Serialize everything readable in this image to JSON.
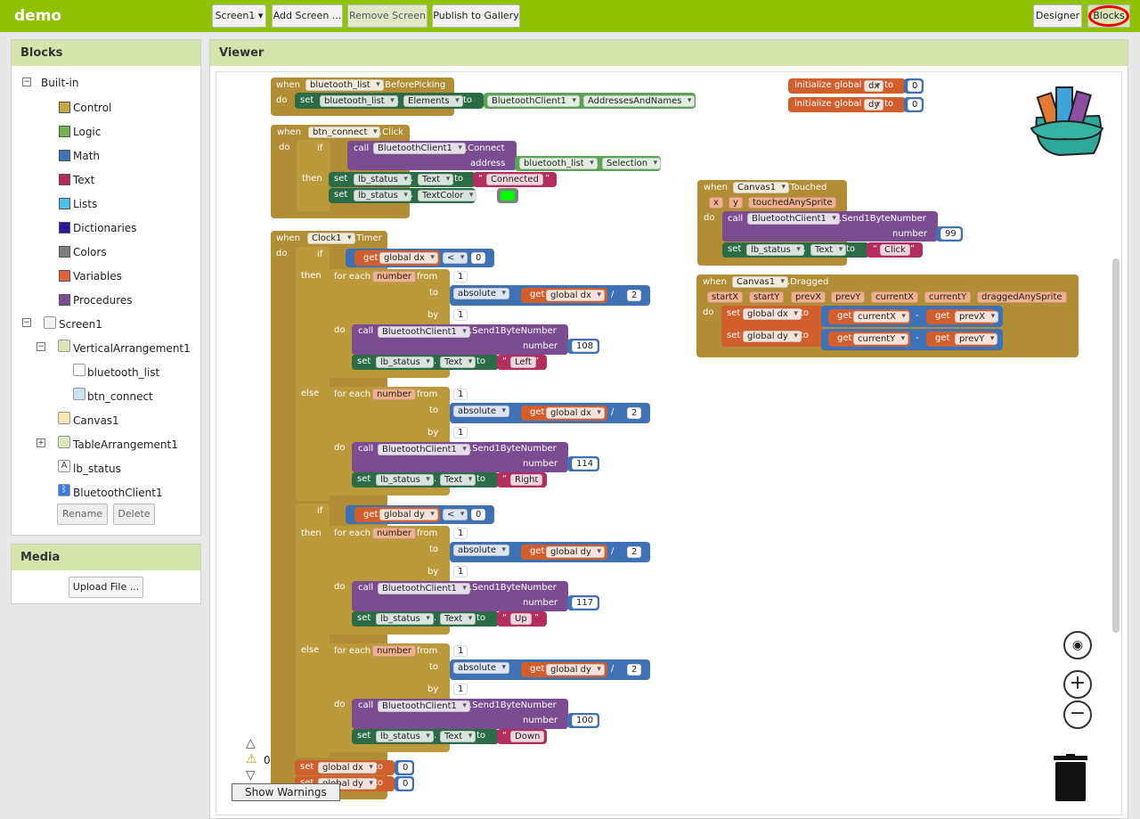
{
  "app": {
    "title": "demo"
  },
  "toolbar": {
    "screen_select": "Screen1 ▾",
    "add_screen": "Add Screen ...",
    "remove_screen": "Remove Screen",
    "publish": "Publish to Gallery",
    "designer": "Designer",
    "blocks": "Blocks"
  },
  "blocks_panel": {
    "title": "Blocks",
    "builtin_label": "Built-in",
    "categories": [
      {
        "label": "Control",
        "color": "#c9a645"
      },
      {
        "label": "Logic",
        "color": "#74b252"
      },
      {
        "label": "Math",
        "color": "#3f71b5"
      },
      {
        "label": "Text",
        "color": "#b32d5e"
      },
      {
        "label": "Lists",
        "color": "#4dbee6"
      },
      {
        "label": "Dictionaries",
        "color": "#2d1799"
      },
      {
        "label": "Colors",
        "color": "#7f7f7f"
      },
      {
        "label": "Variables",
        "color": "#e0643a"
      },
      {
        "label": "Procedures",
        "color": "#7b4c90"
      }
    ],
    "components": {
      "screen": "Screen1",
      "vertical": "VerticalArrangement1",
      "list": "bluetooth_list",
      "btn": "btn_connect",
      "canvas": "Canvas1",
      "table": "TableArrangement1",
      "label": "lb_status",
      "bt": "BluetoothClient1"
    },
    "rename": "Rename",
    "delete": "Delete"
  },
  "media_panel": {
    "title": "Media",
    "upload": "Upload File ..."
  },
  "viewer": {
    "title": "Viewer"
  },
  "warnings": {
    "count": "0",
    "show_label": "Show Warnings"
  },
  "code": {
    "when": "when",
    "do": "do",
    "set": "set",
    "to": "to",
    "call": "call",
    "if": "if",
    "then": "then",
    "else": "else",
    "get": "get",
    "for_each": "for each",
    "from": "from",
    "by": "by",
    "number": "number",
    "address": "address",
    "absolute": "absolute",
    "init_global": "initialize global",
    "dot": ".",
    "lt": "<",
    "div": "/",
    "minus": "-",
    "bluetooth_list": "bluetooth_list",
    "before_picking": ".BeforePicking",
    "elements": "Elements",
    "bt_client": "BluetoothClient1",
    "addresses": "AddressesAndNames",
    "btn_connect": "btn_connect",
    "click": ".Click",
    "connect": ".Connect",
    "selection": "Selection",
    "lb_status": "lb_status",
    "text_prop": "Text",
    "text_color": "TextColor",
    "connected": "Connected",
    "dx": "dx",
    "dy": "dy",
    "zero": "0",
    "one": "1",
    "two": "2",
    "canvas1": "Canvas1",
    "touched": ".Touched",
    "x": "x",
    "y": "y",
    "touched_any": "touchedAnySprite",
    "send1": ".Send1ByteNumber",
    "n99": "99",
    "click_str": "Click",
    "dragged": ".Dragged",
    "startX": "startX",
    "startY": "startY",
    "prevX": "prevX",
    "prevY": "prevY",
    "currentX": "currentX",
    "currentY": "currentY",
    "dragged_any": "draggedAnySprite",
    "global_dx": "global dx",
    "global_dy": "global dy",
    "clock1": "Clock1",
    "timer": ".Timer",
    "n108": "108",
    "left": "Left",
    "n114": "114",
    "right": "Right",
    "n117": "117",
    "up": "Up",
    "n100": "100",
    "down": "Down",
    "q_open": "“",
    "q_close": "”"
  }
}
